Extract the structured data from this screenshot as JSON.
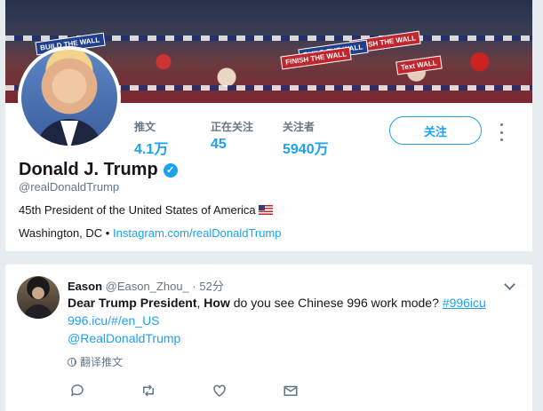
{
  "profile": {
    "name": "Donald J. Trump",
    "handle": "@realDonaldTrump",
    "bio": "45th President of the United States of America",
    "location": "Washington, DC",
    "separator": "•",
    "website": "Instagram.com/realDonaldTrump",
    "verified": true,
    "stats": [
      {
        "label": "推文",
        "value": "4.1万"
      },
      {
        "label": "正在关注",
        "value": "45"
      },
      {
        "label": "关注者",
        "value": "5940万"
      }
    ],
    "follow_label": "关注",
    "banner_signs": [
      "BUILD THE WALL",
      "FINISH THE WALL",
      "BUILD THE WALL",
      "Text WALL",
      "FINISH THE WALL"
    ]
  },
  "tweet": {
    "author": "Eason",
    "handle": "@Eason_Zhou_",
    "time": "· 52分",
    "text_bold": "Dear Trump President",
    "text_comma": ",",
    "text_how": "How",
    "text_rest": " do you see Chinese 996 work mode?",
    "hashtag": "#996icu",
    "link": "996.icu/#/en_US",
    "mention": "@RealDonaldTrump",
    "translate_label": "翻译推文"
  },
  "colors": {
    "accent": "#1da1f2",
    "muted": "#657786",
    "background": "#e6ecf0"
  }
}
